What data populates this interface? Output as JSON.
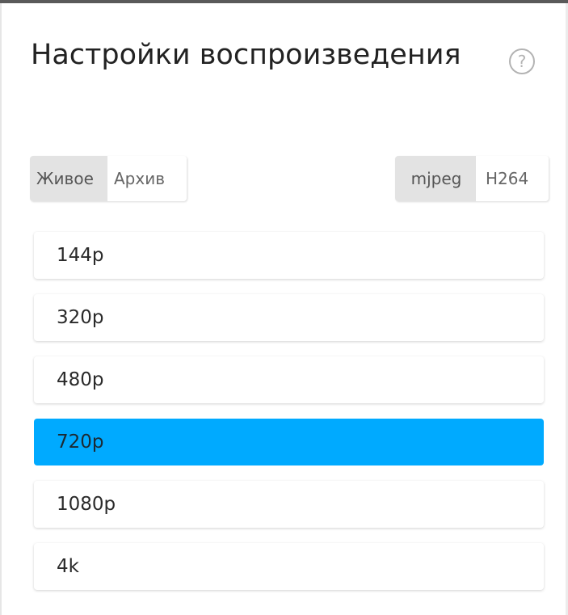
{
  "dialog": {
    "title": "Настройки воспроизведения",
    "help_symbol": "?"
  },
  "mode_toggle": {
    "options": [
      "Живое",
      "Архив"
    ],
    "selected": "Живое"
  },
  "codec_toggle": {
    "options": [
      "mjpeg",
      "H264"
    ],
    "selected": "mjpeg"
  },
  "quality": {
    "options": [
      "144p",
      "320p",
      "480p",
      "720p",
      "1080p",
      "4k"
    ],
    "selected": "720p"
  },
  "colors": {
    "accent": "#00aaff",
    "active_segment": "#e3e3e3"
  }
}
